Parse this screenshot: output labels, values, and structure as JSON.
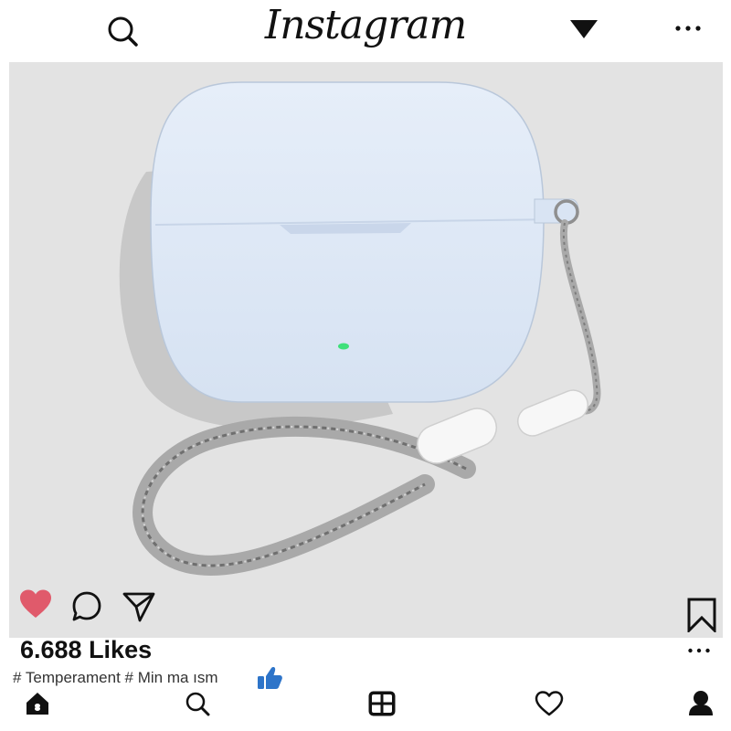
{
  "app": {
    "title": "Instagram"
  },
  "post": {
    "likes_text": "6.688 Likes",
    "caption": "# Temperament # Min ma ısm"
  },
  "icons": {
    "top_search": "search-icon",
    "top_dropdown": "triangle-down-icon",
    "top_more": "more-dots-icon",
    "like": "heart-filled-icon",
    "comment": "comment-bubble-icon",
    "share": "paper-plane-icon",
    "save": "bookmark-icon",
    "thumbs": "thumbs-up-icon",
    "nav": [
      "home-icon",
      "search-icon",
      "add-post-icon",
      "heart-outline-icon",
      "profile-icon"
    ]
  },
  "colors": {
    "like_red": "#e05a6b",
    "thumbs_blue": "#2d74c9",
    "photo_bg": "#e3e3e3",
    "case_blue": "#dde8f6"
  }
}
